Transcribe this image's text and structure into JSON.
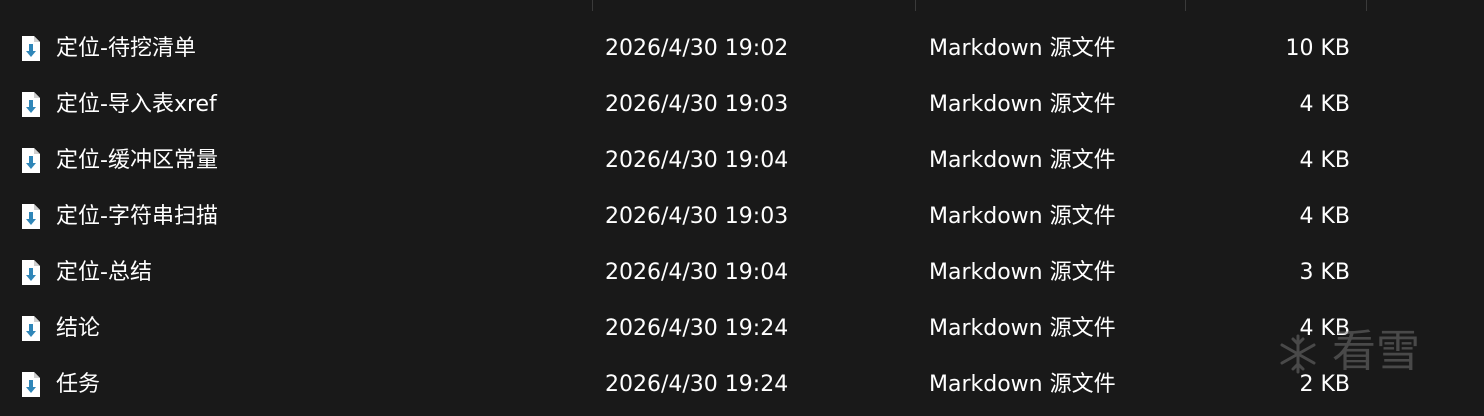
{
  "files": [
    {
      "name": "定位-待挖清单",
      "modified": "2026/4/30 19:02",
      "type": "Markdown 源文件",
      "size": "10 KB",
      "icon": "markdown-file-icon"
    },
    {
      "name": "定位-导入表xref",
      "modified": "2026/4/30 19:03",
      "type": "Markdown 源文件",
      "size": "4 KB",
      "icon": "markdown-file-icon"
    },
    {
      "name": "定位-缓冲区常量",
      "modified": "2026/4/30 19:04",
      "type": "Markdown 源文件",
      "size": "4 KB",
      "icon": "markdown-file-icon"
    },
    {
      "name": "定位-字符串扫描",
      "modified": "2026/4/30 19:03",
      "type": "Markdown 源文件",
      "size": "4 KB",
      "icon": "markdown-file-icon"
    },
    {
      "name": "定位-总结",
      "modified": "2026/4/30 19:04",
      "type": "Markdown 源文件",
      "size": "3 KB",
      "icon": "markdown-file-icon"
    },
    {
      "name": "结论",
      "modified": "2026/4/30 19:24",
      "type": "Markdown 源文件",
      "size": "4 KB",
      "icon": "markdown-file-icon"
    },
    {
      "name": "任务",
      "modified": "2026/4/30 19:24",
      "type": "Markdown 源文件",
      "size": "2 KB",
      "icon": "markdown-file-icon"
    }
  ],
  "watermark": {
    "text": "看雪"
  },
  "colors": {
    "background": "#191919",
    "text": "#ffffff",
    "icon_arrow": "#2f86b8",
    "watermark": "#7a7a7a"
  }
}
